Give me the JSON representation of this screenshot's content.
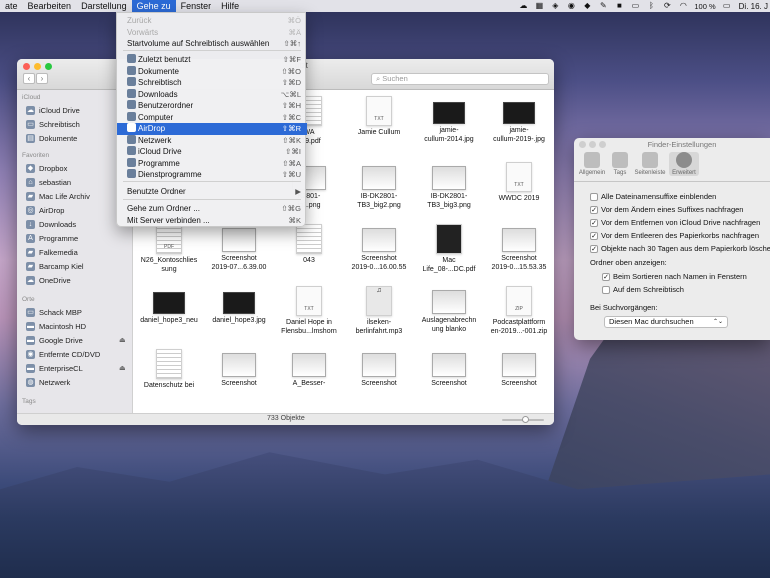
{
  "menubar": {
    "items": [
      "ate",
      "Bearbeiten",
      "Darstellung",
      "Gehe zu",
      "Fenster",
      "Hilfe"
    ],
    "active_index": 3,
    "battery": "100 %",
    "clock": "Di. 16. J",
    "status_icons": [
      "cloud-icon",
      "grid-icon",
      "shield-icon",
      "camera-icon",
      "dropbox-icon",
      "pencil-icon",
      "stop-icon",
      "airplay-icon",
      "bluetooth-icon",
      "sync-icon",
      "wifi-icon",
      "battery-icon"
    ]
  },
  "gehe_zu_menu": {
    "items": [
      {
        "label": "Zurück",
        "shortcut": "⌘Ö",
        "disabled": true
      },
      {
        "label": "Vorwärts",
        "shortcut": "⌘Ä",
        "disabled": true
      },
      {
        "label": "Startvolume auf Schreibtisch auswählen",
        "shortcut": "⇧⌘↑"
      },
      {
        "label": "Zuletzt benutzt",
        "shortcut": "⇧⌘F",
        "icon": "recents-icon"
      },
      {
        "label": "Dokumente",
        "shortcut": "⇧⌘O",
        "icon": "documents-icon"
      },
      {
        "label": "Schreibtisch",
        "shortcut": "⇧⌘D",
        "icon": "desktop-icon"
      },
      {
        "label": "Downloads",
        "shortcut": "⌥⌘L",
        "icon": "downloads-icon"
      },
      {
        "label": "Benutzerordner",
        "shortcut": "⇧⌘H",
        "icon": "home-icon"
      },
      {
        "label": "Computer",
        "shortcut": "⇧⌘C",
        "icon": "computer-icon"
      },
      {
        "label": "AirDrop",
        "shortcut": "⇧⌘R",
        "icon": "airdrop-icon",
        "selected": true
      },
      {
        "label": "Netzwerk",
        "shortcut": "⇧⌘K",
        "icon": "network-icon"
      },
      {
        "label": "iCloud Drive",
        "shortcut": "⇧⌘I",
        "icon": "icloud-icon"
      },
      {
        "label": "Programme",
        "shortcut": "⇧⌘A",
        "icon": "applications-icon"
      },
      {
        "label": "Dienstprogramme",
        "shortcut": "⇧⌘U",
        "icon": "utilities-icon"
      },
      {
        "label": "Benutzte Ordner",
        "shortcut": "▶"
      },
      {
        "label": "Gehe zum Ordner ...",
        "shortcut": "⇧⌘G"
      },
      {
        "label": "Mit Server verbinden ...",
        "shortcut": "⌘K"
      }
    ]
  },
  "finder": {
    "title_fragment": "utzt",
    "search_placeholder": "Suchen",
    "status": "733 Objekte",
    "sidebar": {
      "icloud_header": "iCloud",
      "icloud": [
        "iCloud Drive",
        "Schreibtisch",
        "Dokumente"
      ],
      "favorites_header": "Favoriten",
      "favorites": [
        "Dropbox",
        "sebastian",
        "Mac Life Archiv",
        "AirDrop",
        "Downloads",
        "Programme",
        "Falkemedia",
        "Barcamp Kiel",
        "OneDrive"
      ],
      "places_header": "Orte",
      "places": [
        "Schack MBP",
        "Macintosh HD",
        "Google Drive",
        "Entfernte CD/DVD",
        "EnterpriseCL",
        "Netzwerk"
      ],
      "tags_header": "Tags"
    },
    "files": [
      {
        "name": "WA\n619.pdf",
        "kind": "pdf"
      },
      {
        "name": "Jamie Cullum",
        "kind": "txt",
        "tag": "TXT"
      },
      {
        "name": "jamie-\ncullum-2014.jpg",
        "kind": "img"
      },
      {
        "name": "jamie-\ncullum-2019-.jpg",
        "kind": "img"
      },
      {
        "name": "K2801-\nig1.png",
        "kind": "scr"
      },
      {
        "name": "IB-DK2801-\nTB3_big2.png",
        "kind": "scr"
      },
      {
        "name": "IB-DK2801-\nTB3_big3.png",
        "kind": "scr"
      },
      {
        "name": "WWDC 2019",
        "kind": "txt",
        "tag": "TXT"
      },
      {
        "name": "N26_Kontoschlies\nsung",
        "kind": "pdf",
        "tag": "PDF"
      },
      {
        "name": "Screenshot\n2019-07...6.39.00",
        "kind": "scr"
      },
      {
        "name": "043",
        "kind": "pdf"
      },
      {
        "name": "Screenshot\n2019-0...16.00.55",
        "kind": "scr"
      },
      {
        "name": "Mac\nLife_08-...DC.pdf",
        "kind": "dark"
      },
      {
        "name": "Screenshot\n2019-0...15.53.35",
        "kind": "scr"
      },
      {
        "name": "daniel_hope3_neu",
        "kind": "img"
      },
      {
        "name": "daniel_hope3.jpg",
        "kind": "img"
      },
      {
        "name": "Daniel Hope in\nFlensbu...lmshorn",
        "kind": "txt",
        "tag": "TXT"
      },
      {
        "name": "ilseken-\nberlinfahrt.mp3",
        "kind": "music"
      },
      {
        "name": "Auslagenabrechn\nung blanko",
        "kind": "scr"
      },
      {
        "name": "Podcastplattform\nen-2019...-001.zip",
        "kind": "txt",
        "tag": "ZIP"
      },
      {
        "name": "Datenschutz bei",
        "kind": "pdf"
      },
      {
        "name": "Screenshot",
        "kind": "scr"
      },
      {
        "name": "A_Besser-",
        "kind": "scr"
      },
      {
        "name": "Screenshot",
        "kind": "scr"
      },
      {
        "name": "Screenshot",
        "kind": "scr"
      },
      {
        "name": "Screenshot",
        "kind": "scr"
      }
    ]
  },
  "prefs": {
    "title": "Finder-Einstellungen",
    "tabs": [
      "Allgemein",
      "Tags",
      "Seitenleiste",
      "Erweitert"
    ],
    "selected_tab": 3,
    "checkboxes": [
      {
        "label": "Alle Dateinamensuffixe einblenden",
        "checked": false
      },
      {
        "label": "Vor dem Ändern eines Suffixes nachfragen",
        "checked": true
      },
      {
        "label": "Vor dem Entfernen von iCloud Drive nachfragen",
        "checked": true
      },
      {
        "label": "Vor dem Entleeren des Papierkorbs nachfragen",
        "checked": true
      },
      {
        "label": "Objekte nach 30 Tagen aus dem Papierkorb löschen",
        "checked": true
      }
    ],
    "folders_label": "Ordner oben anzeigen:",
    "folders_options": [
      {
        "label": "Beim Sortieren nach Namen in Fenstern",
        "checked": true
      },
      {
        "label": "Auf dem Schreibtisch",
        "checked": false
      }
    ],
    "search_label": "Bei Suchvorgängen:",
    "search_value": "Diesen Mac durchsuchen"
  }
}
